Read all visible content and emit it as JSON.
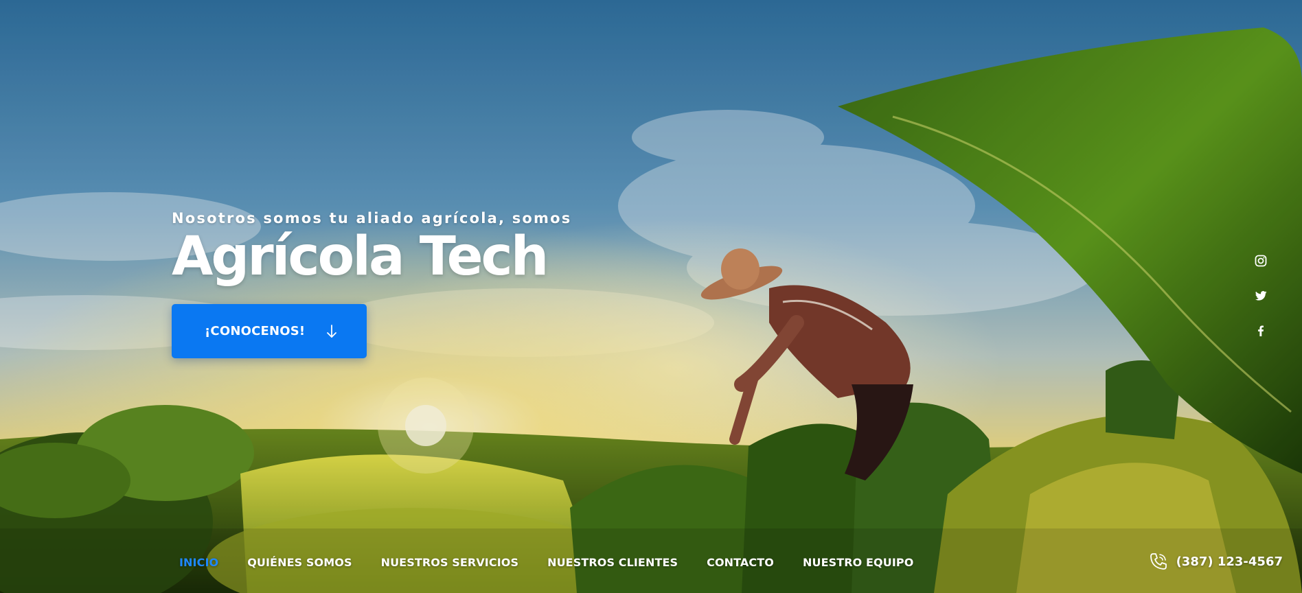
{
  "hero": {
    "eyebrow": "Nosotros somos tu aliado agrícola, somos",
    "headline": "Agrícola Tech",
    "cta_label": "¡CONOCENOS!"
  },
  "social": [
    {
      "name": "instagram-icon"
    },
    {
      "name": "twitter-icon"
    },
    {
      "name": "facebook-icon"
    }
  ],
  "nav": {
    "items": [
      "INICIO",
      "QUIÉNES SOMOS",
      "NUESTROS SERVICIOS",
      "NUESTROS CLIENTES",
      "CONTACTO",
      "NUESTRO EQUIPO"
    ],
    "active_index": 0
  },
  "contact": {
    "phone": "(387) 123-4567"
  },
  "colors": {
    "accent": "#0a78f2",
    "nav_active": "#1e88ff",
    "text": "#ffffff"
  }
}
